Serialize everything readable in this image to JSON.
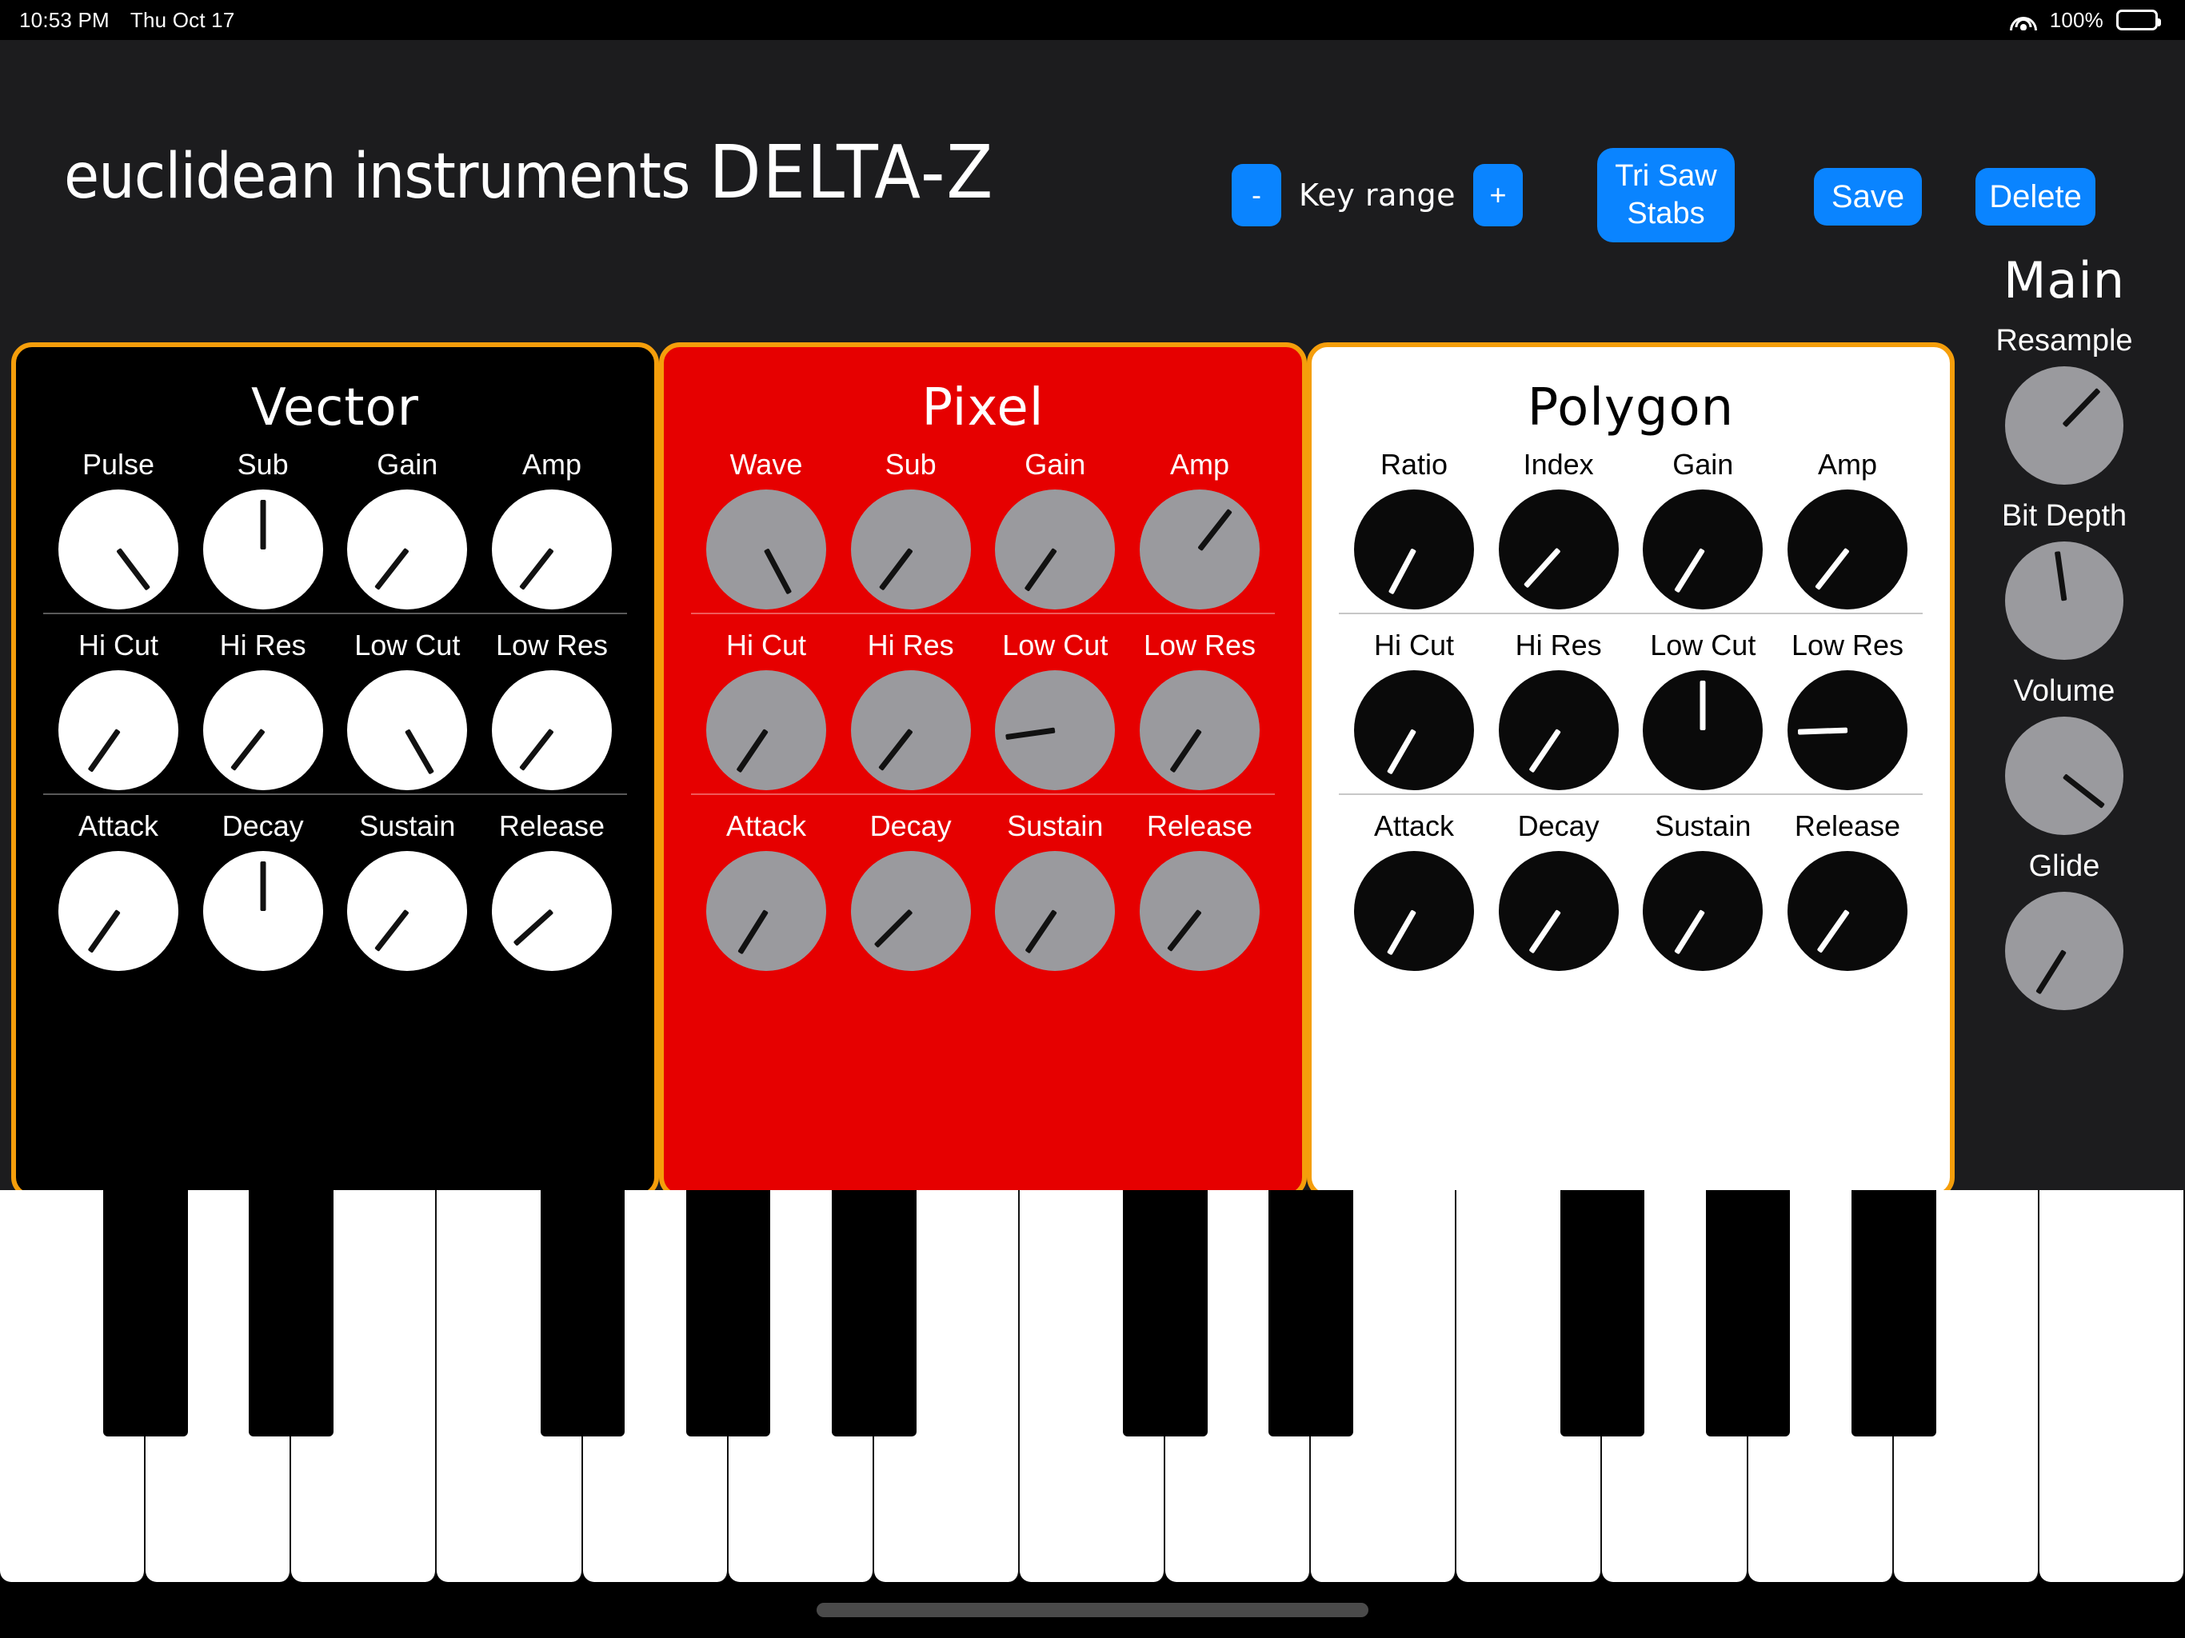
{
  "status_bar": {
    "time": "10:53 PM",
    "date": "Thu Oct 17",
    "battery_percent": "100%",
    "wifi_icon": "wifi-icon",
    "battery_icon": "battery-icon"
  },
  "header": {
    "logo_brand": "euclidean instruments",
    "logo_model": "DELTA-Z",
    "key_range": {
      "minus": "-",
      "label": "Key range",
      "plus": "+"
    },
    "preset_name": "Tri Saw Stabs",
    "save_label": "Save",
    "delete_label": "Delete"
  },
  "panels": [
    {
      "id": "vector",
      "title": "Vector",
      "background": "#000000",
      "knob_color": "#ffffff",
      "pointer_color": "#111111",
      "border_color": "#f59e0b",
      "rows": [
        {
          "cells": [
            {
              "label": "Pulse",
              "angle": 143
            },
            {
              "label": "Sub",
              "angle": 0
            },
            {
              "label": "Gain",
              "angle": 218
            },
            {
              "label": "Amp",
              "angle": 218
            }
          ]
        },
        {
          "cells": [
            {
              "label": "Hi Cut",
              "angle": 215
            },
            {
              "label": "Hi Res",
              "angle": 218
            },
            {
              "label": "Low Cut",
              "angle": 150
            },
            {
              "label": "Low Res",
              "angle": 218
            }
          ]
        },
        {
          "cells": [
            {
              "label": "Attack",
              "angle": 215
            },
            {
              "label": "Decay",
              "angle": 0
            },
            {
              "label": "Sustain",
              "angle": 218
            },
            {
              "label": "Release",
              "angle": 228
            }
          ]
        }
      ]
    },
    {
      "id": "pixel",
      "title": "Pixel",
      "background": "#e60000",
      "knob_color": "#9a9a9e",
      "pointer_color": "#111111",
      "border_color": "#f59e0b",
      "rows": [
        {
          "cells": [
            {
              "label": "Wave",
              "angle": 152
            },
            {
              "label": "Sub",
              "angle": 217
            },
            {
              "label": "Gain",
              "angle": 215
            },
            {
              "label": "Amp",
              "angle": 38
            }
          ]
        },
        {
          "cells": [
            {
              "label": "Hi Cut",
              "angle": 214
            },
            {
              "label": "Hi Res",
              "angle": 218
            },
            {
              "label": "Low Cut",
              "angle": 262
            },
            {
              "label": "Low Res",
              "angle": 214
            }
          ]
        },
        {
          "cells": [
            {
              "label": "Attack",
              "angle": 212
            },
            {
              "label": "Decay",
              "angle": 225
            },
            {
              "label": "Sustain",
              "angle": 214
            },
            {
              "label": "Release",
              "angle": 218
            }
          ]
        }
      ]
    },
    {
      "id": "polygon",
      "title": "Polygon",
      "background": "#ffffff",
      "knob_color": "#0a0a0a",
      "pointer_color": "#ffffff",
      "border_color": "#f59e0b",
      "rows": [
        {
          "cells": [
            {
              "label": "Ratio",
              "angle": 208
            },
            {
              "label": "Index",
              "angle": 222
            },
            {
              "label": "Gain",
              "angle": 212
            },
            {
              "label": "Amp",
              "angle": 218
            }
          ]
        },
        {
          "cells": [
            {
              "label": "Hi Cut",
              "angle": 210
            },
            {
              "label": "Hi Res",
              "angle": 214
            },
            {
              "label": "Low Cut",
              "angle": 0
            },
            {
              "label": "Low Res",
              "angle": 268
            }
          ]
        },
        {
          "cells": [
            {
              "label": "Attack",
              "angle": 210
            },
            {
              "label": "Decay",
              "angle": 214
            },
            {
              "label": "Sustain",
              "angle": 212
            },
            {
              "label": "Release",
              "angle": 215
            }
          ]
        }
      ]
    }
  ],
  "main": {
    "title": "Main",
    "knob_color": "#9a9a9e",
    "pointer_color": "#111111",
    "controls": [
      {
        "label": "Resample",
        "angle": 44
      },
      {
        "label": "Bit Depth",
        "angle": 352
      },
      {
        "label": "Volume",
        "angle": 128
      },
      {
        "label": "Glide",
        "angle": 212
      }
    ]
  },
  "keyboard": {
    "white_key_count": 15,
    "black_key_pattern": [
      1,
      1,
      0,
      1,
      1,
      1,
      0
    ],
    "white_key_color": "#ffffff",
    "black_key_color": "#000000"
  },
  "home_indicator": "home-indicator"
}
